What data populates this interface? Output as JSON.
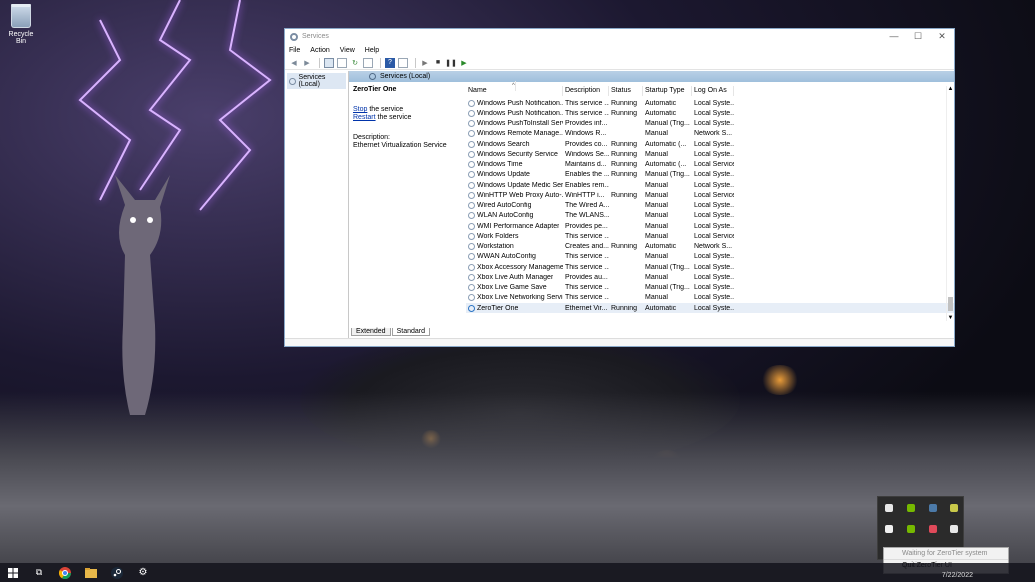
{
  "desktop": {
    "recycle_bin_label": "Recycle Bin"
  },
  "window": {
    "title": "Services",
    "controls": {
      "minimize": "—",
      "maximize": "☐",
      "close": "✕"
    },
    "menu": [
      "File",
      "Action",
      "View",
      "Help"
    ],
    "tree_node": "Services (Local)",
    "pane_header": "Services (Local)"
  },
  "detail": {
    "service_name": "ZeroTier One",
    "stop_link": "Stop",
    "stop_suffix": " the service",
    "restart_link": "Restart",
    "restart_suffix": " the service",
    "description_label": "Description:",
    "description_text": "Ethernet Virtualization Service"
  },
  "columns": [
    "Name",
    "Description",
    "Status",
    "Startup Type",
    "Log On As"
  ],
  "services": [
    {
      "name": "Windows Push Notification...",
      "desc": "This service ...",
      "status": "Running",
      "startup": "Automatic",
      "logon": "Local Syste..."
    },
    {
      "name": "Windows Push Notification...",
      "desc": "This service ...",
      "status": "Running",
      "startup": "Automatic",
      "logon": "Local Syste..."
    },
    {
      "name": "Windows PushToInstall Serv...",
      "desc": "Provides inf...",
      "status": "",
      "startup": "Manual (Trig...",
      "logon": "Local Syste..."
    },
    {
      "name": "Windows Remote Manage...",
      "desc": "Windows R...",
      "status": "",
      "startup": "Manual",
      "logon": "Network S..."
    },
    {
      "name": "Windows Search",
      "desc": "Provides co...",
      "status": "Running",
      "startup": "Automatic (...",
      "logon": "Local Syste..."
    },
    {
      "name": "Windows Security Service",
      "desc": "Windows Se...",
      "status": "Running",
      "startup": "Manual",
      "logon": "Local Syste..."
    },
    {
      "name": "Windows Time",
      "desc": "Maintains d...",
      "status": "Running",
      "startup": "Automatic (...",
      "logon": "Local Service"
    },
    {
      "name": "Windows Update",
      "desc": "Enables the ...",
      "status": "Running",
      "startup": "Manual (Trig...",
      "logon": "Local Syste..."
    },
    {
      "name": "Windows Update Medic Ser...",
      "desc": "Enables rem...",
      "status": "",
      "startup": "Manual",
      "logon": "Local Syste..."
    },
    {
      "name": "WinHTTP Web Proxy Auto-...",
      "desc": "WinHTTP i...",
      "status": "Running",
      "startup": "Manual",
      "logon": "Local Service"
    },
    {
      "name": "Wired AutoConfig",
      "desc": "The Wired A...",
      "status": "",
      "startup": "Manual",
      "logon": "Local Syste..."
    },
    {
      "name": "WLAN AutoConfig",
      "desc": "The WLANS...",
      "status": "",
      "startup": "Manual",
      "logon": "Local Syste..."
    },
    {
      "name": "WMI Performance Adapter",
      "desc": "Provides pe...",
      "status": "",
      "startup": "Manual",
      "logon": "Local Syste..."
    },
    {
      "name": "Work Folders",
      "desc": "This service ...",
      "status": "",
      "startup": "Manual",
      "logon": "Local Service"
    },
    {
      "name": "Workstation",
      "desc": "Creates and...",
      "status": "Running",
      "startup": "Automatic",
      "logon": "Network S..."
    },
    {
      "name": "WWAN AutoConfig",
      "desc": "This service ...",
      "status": "",
      "startup": "Manual",
      "logon": "Local Syste..."
    },
    {
      "name": "Xbox Accessory Manageme...",
      "desc": "This service ...",
      "status": "",
      "startup": "Manual (Trig...",
      "logon": "Local Syste..."
    },
    {
      "name": "Xbox Live Auth Manager",
      "desc": "Provides au...",
      "status": "",
      "startup": "Manual",
      "logon": "Local Syste..."
    },
    {
      "name": "Xbox Live Game Save",
      "desc": "This service ...",
      "status": "",
      "startup": "Manual (Trig...",
      "logon": "Local Syste..."
    },
    {
      "name": "Xbox Live Networking Service",
      "desc": "This service ...",
      "status": "",
      "startup": "Manual",
      "logon": "Local Syste..."
    },
    {
      "name": "ZeroTier One",
      "desc": "Ethernet Vir...",
      "status": "Running",
      "startup": "Automatic",
      "logon": "Local Syste..."
    }
  ],
  "selected_service": "ZeroTier One",
  "tabs": [
    "Extended",
    "Standard"
  ],
  "tray_menu": {
    "status_item": "Waiting for ZeroTier system service...",
    "quit_item": "Quit ZeroTier UI"
  },
  "taskbar": {
    "clock": "7/22/2022"
  },
  "colors": {
    "accent": "#2b74c4",
    "header_bar": "#a9c6e0",
    "lightning": "#d9b3ff"
  }
}
